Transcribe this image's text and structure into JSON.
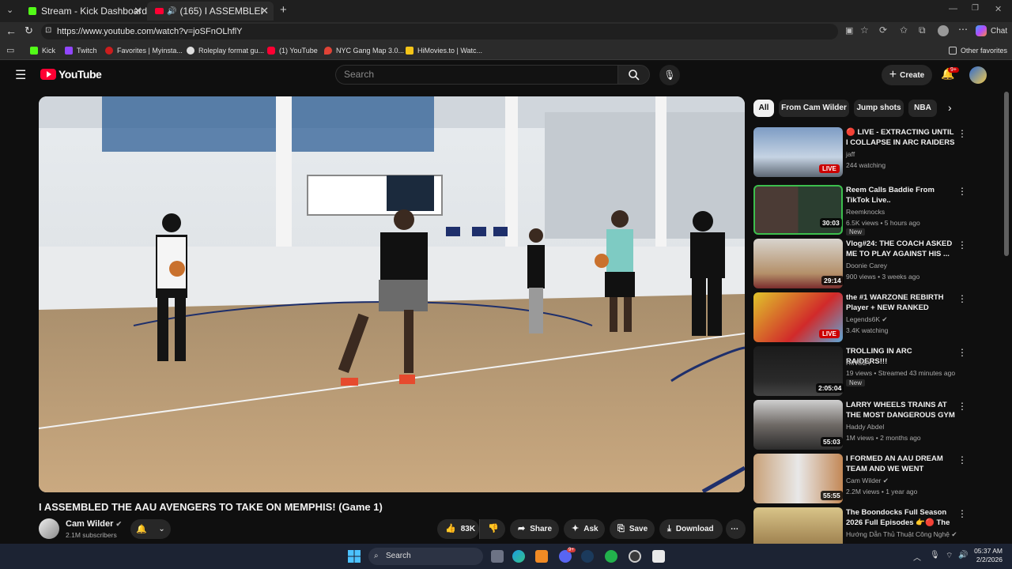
{
  "browser": {
    "tabs": [
      {
        "title": "Stream - Kick Dashboard"
      },
      {
        "title": "(165) I ASSEMBLED THE AAU"
      }
    ],
    "url": "https://www.youtube.com/watch?v=joSFnOLhflY",
    "chat_label": "Chat",
    "bookmarks": [
      "Kick",
      "Twitch",
      "Favorites | Myinsta...",
      "Roleplay format gu...",
      "(1) YouTube",
      "NYC Gang Map 3.0...",
      "HiMovies.to | Watc..."
    ],
    "other_favorites": "Other favorites"
  },
  "youtube": {
    "logo": "YouTube",
    "search_placeholder": "Search",
    "create_label": "Create",
    "notif_badge": "9+"
  },
  "video": {
    "title": "I ASSEMBLED THE AAU AVENGERS TO TAKE ON MEMPHIS! (Game 1)",
    "channel": "Cam Wilder",
    "subscribers": "2.1M subscribers",
    "likes": "83K",
    "share": "Share",
    "ask": "Ask",
    "save": "Save",
    "download": "Download"
  },
  "chips": [
    "All",
    "From Cam Wilder",
    "Jump shots",
    "NBA"
  ],
  "recommendations": [
    {
      "title": "🔴 LIVE - EXTRACTING UNTIL I COLLAPSE IN ARC RAIDERS | ...",
      "channel": "jaff",
      "meta": "244 watching",
      "badge": "",
      "overlay": "LIVE"
    },
    {
      "title": "Reem Calls Baddie From TikTok Live..",
      "channel": "Reemknocks",
      "meta": "6.5K views • 5 hours ago",
      "badge": "New",
      "overlay": "30:03"
    },
    {
      "title": "Vlog#24: THE COACH ASKED ME TO PLAY AGAINST HIS ...",
      "channel": "Doonie Carey",
      "meta": "900 views • 3 weeks ago",
      "badge": "",
      "overlay": "29:14"
    },
    {
      "title": "the #1 WARZONE REBIRTH Player + NEW RANKED UPDATE",
      "channel": "Legends6K ✔",
      "meta": "3.4K watching",
      "badge": "",
      "overlay": "LIVE"
    },
    {
      "title": "TROLLING IN ARC RAIDERS!!!",
      "channel": "RINGZY",
      "meta": "19 views • Streamed 43 minutes ago",
      "badge": "New",
      "overlay": "2:05:04"
    },
    {
      "title": "LARRY WHEELS TRAINS AT THE MOST DANGEROUS GYM ...",
      "channel": "Haddy Abdel",
      "meta": "1M views • 2 months ago",
      "badge": "",
      "overlay": "55:03"
    },
    {
      "title": "I FORMED AN AAU DREAM TEAM AND WE WENT INSANE!...",
      "channel": "Cam Wilder ✔",
      "meta": "2.2M views • 1 year ago",
      "badge": "",
      "overlay": "55:55"
    },
    {
      "title": "The Boondocks Full Season 2026 Full Episodes 👉🔴 The ...",
      "channel": "Hướng Dẫn Thủ Thuật Công Nghệ ✔",
      "meta": "",
      "badge": "",
      "overlay": ""
    }
  ],
  "taskbar": {
    "search": "Search",
    "time": "05:37 AM",
    "date": "2/2/2026",
    "badge": "9+"
  }
}
